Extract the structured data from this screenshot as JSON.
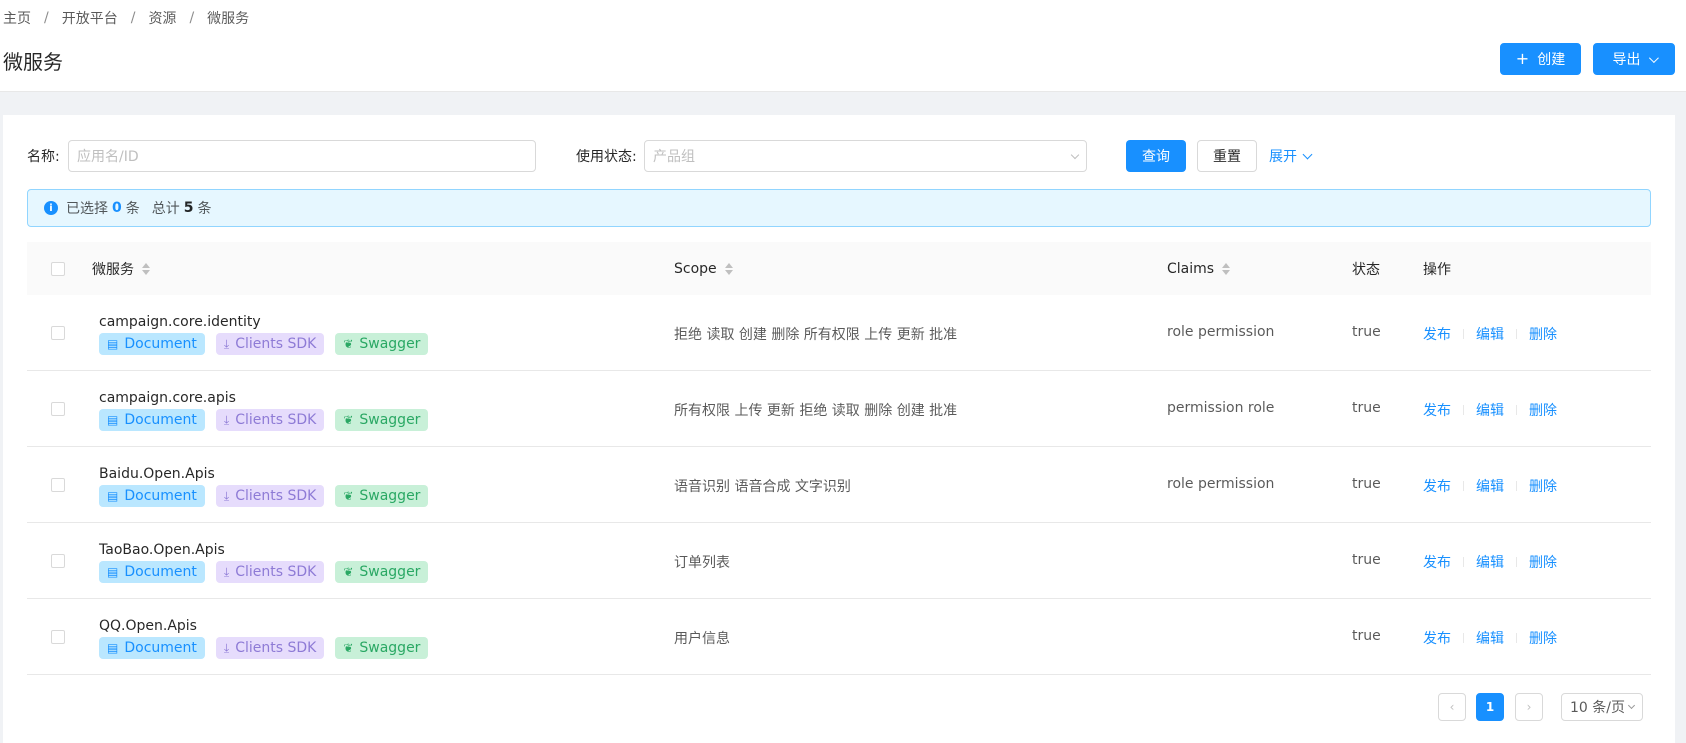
{
  "breadcrumb": [
    "主页",
    "开放平台",
    "资源",
    "微服务"
  ],
  "page": {
    "title": "微服务"
  },
  "toolbar": {
    "create_label": "创建",
    "export_label": "导出"
  },
  "filters": {
    "name_label": "名称:",
    "name_placeholder": "应用名/ID",
    "status_label": "使用状态:",
    "status_placeholder": "产品组",
    "query_label": "查询",
    "reset_label": "重置",
    "expand_label": "展开"
  },
  "alert": {
    "selected_prefix": "已选择",
    "selected_count": "0",
    "selected_suffix": "条",
    "total_prefix": "总计",
    "total_count": "5",
    "total_suffix": "条"
  },
  "table": {
    "columns": [
      "微服务",
      "Scope",
      "Claims",
      "状态",
      "操作"
    ],
    "tag_labels": {
      "doc": "Document",
      "sdk": "Clients SDK",
      "swagger": "Swagger"
    },
    "action_labels": {
      "publish": "发布",
      "edit": "编辑",
      "delete": "删除"
    },
    "rows": [
      {
        "name": "campaign.core.identity",
        "scope": "拒绝 读取 创建 删除 所有权限 上传 更新 批准",
        "claims": "role permission",
        "status": "true"
      },
      {
        "name": "campaign.core.apis",
        "scope": "所有权限 上传 更新 拒绝 读取 删除 创建 批准",
        "claims": "permission role",
        "status": "true"
      },
      {
        "name": "Baidu.Open.Apis",
        "scope": "语音识别 语音合成 文字识别",
        "claims": "role permission",
        "status": "true"
      },
      {
        "name": "TaoBao.Open.Apis",
        "scope": "订单列表",
        "claims": "",
        "status": "true"
      },
      {
        "name": "QQ.Open.Apis",
        "scope": "用户信息",
        "claims": "",
        "status": "true"
      }
    ]
  },
  "pagination": {
    "current": "1",
    "page_size": "10 条/页"
  },
  "colors": {
    "primary": "#1890ff",
    "tag_doc_bg": "#bae7ff",
    "tag_sdk_bg": "#e6dcfc",
    "tag_swagger_bg": "#c8f0d8"
  }
}
